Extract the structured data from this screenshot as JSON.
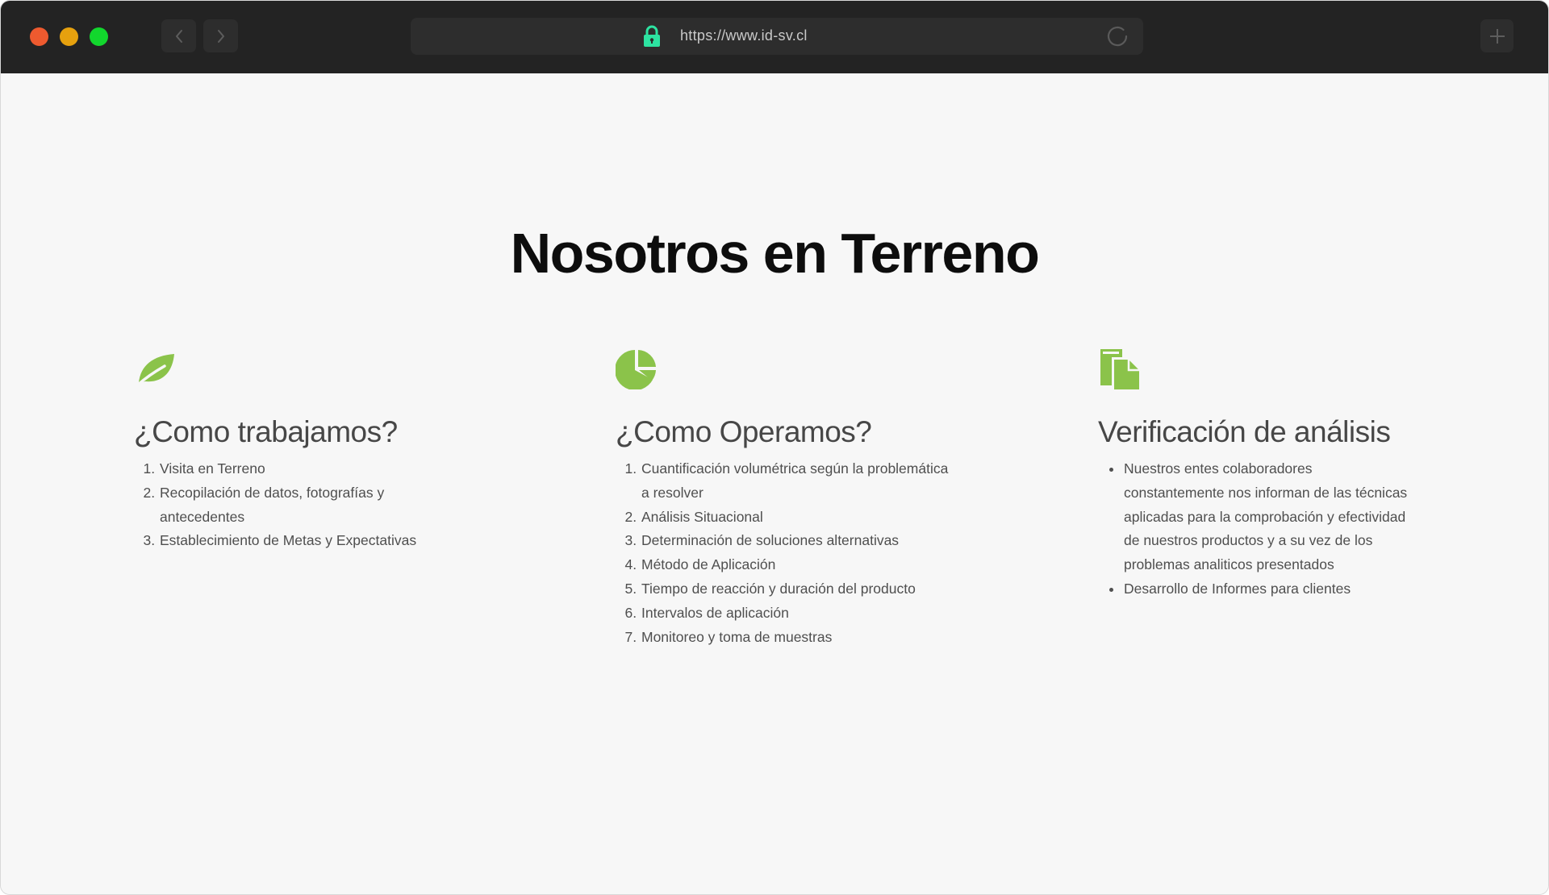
{
  "browser": {
    "url": "https://www.id-sv.cl",
    "colors": {
      "chrome": "#232323",
      "control": "#2d2d2d",
      "close": "#ee5a2f",
      "minimize": "#e6a10e",
      "maximize": "#12d72d",
      "lock": "#2de3a1"
    },
    "icons": {
      "back": "chevron-left-icon",
      "forward": "chevron-right-icon",
      "lock": "lock-icon",
      "reload": "reload-icon",
      "new_tab": "plus-icon"
    }
  },
  "page": {
    "title": "Nosotros en Terreno",
    "accent_color": "#8bc34a",
    "columns": [
      {
        "icon": "leaf-icon",
        "heading": "¿Como trabajamos?",
        "list_type": "ordered",
        "items": [
          "Visita en Terreno",
          "Recopilación de datos, fotografías y antecedentes",
          "Establecimiento de Metas y Expectativas"
        ]
      },
      {
        "icon": "pie-chart-icon",
        "heading": "¿Como Operamos?",
        "list_type": "ordered",
        "items": [
          "Cuantificación volumétrica según la problemática a resolver",
          "Análisis Situacional",
          "Determinación de soluciones alternativas",
          "Método de Aplicación",
          "Tiempo de reacción y duración del producto",
          "Intervalos de aplicación",
          "Monitoreo y toma de muestras"
        ]
      },
      {
        "icon": "documents-icon",
        "heading": "Verificación de análisis",
        "list_type": "unordered",
        "items": [
          "Nuestros entes colaboradores constantemente nos informan de las técnicas aplicadas para la comprobación y efectividad de nuestros productos y a su vez de los problemas analiticos presentados",
          "Desarrollo de Informes para clientes"
        ]
      }
    ]
  }
}
